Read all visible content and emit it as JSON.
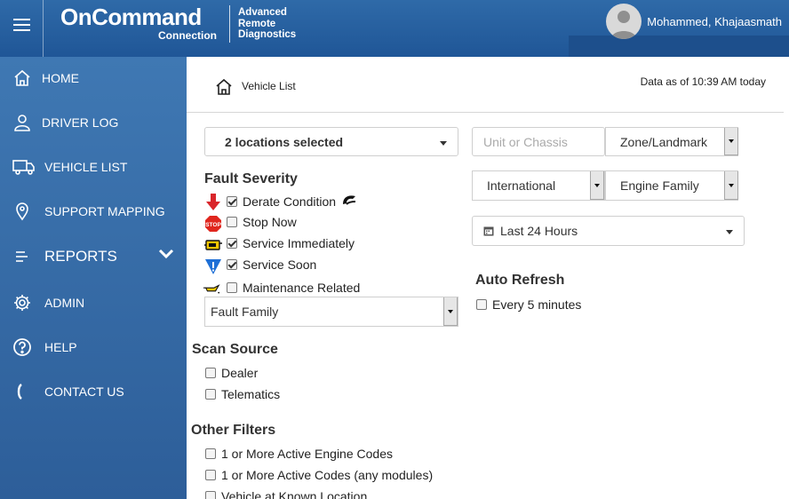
{
  "header": {
    "logo_main": "OnCommand",
    "logo_sub": "Connection",
    "logo_product_lines": [
      "Advanced",
      "Remote",
      "Diagnostics"
    ],
    "user_name": "Mohammed, Khajaasmath"
  },
  "sidebar": {
    "items": [
      {
        "label": "HOME",
        "icon": "home-icon"
      },
      {
        "label": "DRIVER LOG",
        "icon": "user-icon"
      },
      {
        "label": "VEHICLE LIST",
        "icon": "truck-icon"
      },
      {
        "label": "SUPPORT MAPPING",
        "icon": "map-pin-icon"
      },
      {
        "label": "REPORTS",
        "icon": "list-icon"
      },
      {
        "label": "ADMIN",
        "icon": "gear-icon"
      },
      {
        "label": "HELP",
        "icon": "help-icon"
      },
      {
        "label": "CONTACT US",
        "icon": "phone-icon"
      }
    ]
  },
  "breadcrumb": {
    "current": "Vehicle List"
  },
  "data_as_of": "Data as of 10:39 AM today",
  "filters": {
    "locations": "2 locations selected",
    "unit_placeholder": "Unit or Chassis",
    "zone": "Zone/Landmark",
    "make": "International",
    "engine_family": "Engine Family",
    "time_range": "Last 24 Hours",
    "fault_family": "Fault Family"
  },
  "fault_severity": {
    "title": "Fault Severity",
    "items": [
      {
        "label": "Derate Condition",
        "checked": true,
        "icon": "derate-arrow-icon"
      },
      {
        "label": "Stop Now",
        "checked": false,
        "icon": "stop-sign-icon"
      },
      {
        "label": "Service Immediately",
        "checked": true,
        "icon": "engine-warning-icon"
      },
      {
        "label": "Service Soon",
        "checked": true,
        "icon": "warning-triangle-icon"
      },
      {
        "label": "Maintenance Related",
        "checked": false,
        "icon": "oil-can-icon"
      }
    ]
  },
  "auto_refresh": {
    "title": "Auto Refresh",
    "label": "Every 5 minutes",
    "checked": false
  },
  "scan_source": {
    "title": "Scan Source",
    "items": [
      {
        "label": "Dealer",
        "checked": false
      },
      {
        "label": "Telematics",
        "checked": false
      }
    ]
  },
  "other_filters": {
    "title": "Other Filters",
    "items": [
      {
        "label": "1 or More Active Engine Codes",
        "checked": false
      },
      {
        "label": "1 or More Active Codes (any modules)",
        "checked": false
      },
      {
        "label": "Vehicle at Known Location",
        "checked": false
      }
    ]
  },
  "colors": {
    "header": "#2b64a3",
    "sidebar": "#3a72ad",
    "accent_red": "#d9262b",
    "accent_blue": "#1e6fd6"
  }
}
